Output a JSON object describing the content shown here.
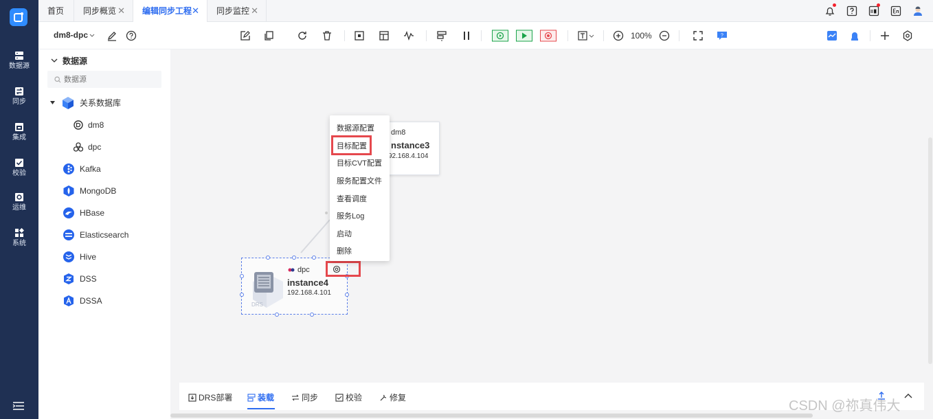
{
  "leftnav": {
    "items": [
      {
        "label": "数据源",
        "icon": "database-icon"
      },
      {
        "label": "同步",
        "icon": "sync-icon"
      },
      {
        "label": "集成",
        "icon": "integration-icon"
      },
      {
        "label": "校验",
        "icon": "check-icon"
      },
      {
        "label": "运维",
        "icon": "ops-icon"
      },
      {
        "label": "系统",
        "icon": "system-icon"
      }
    ]
  },
  "tabs": [
    {
      "label": "首页",
      "closable": false
    },
    {
      "label": "同步概览",
      "closable": true
    },
    {
      "label": "编辑同步工程",
      "closable": true,
      "active": true
    },
    {
      "label": "同步监控",
      "closable": true
    }
  ],
  "toolbar": {
    "project": "dm8-dpc",
    "zoom": "100%"
  },
  "sidebar": {
    "title": "数据源",
    "search_placeholder": "数据源",
    "tree": [
      {
        "label": "关系数据库",
        "icon": "relational-db-icon"
      },
      {
        "label": "dm8",
        "icon": "dm8-icon"
      },
      {
        "label": "dpc",
        "icon": "dpc-icon"
      },
      {
        "label": "Kafka",
        "icon": "kafka-icon"
      },
      {
        "label": "MongoDB",
        "icon": "mongodb-icon"
      },
      {
        "label": "HBase",
        "icon": "hbase-icon"
      },
      {
        "label": "Elasticsearch",
        "icon": "elasticsearch-icon"
      },
      {
        "label": "Hive",
        "icon": "hive-icon"
      },
      {
        "label": "DSS",
        "icon": "dss-icon"
      },
      {
        "label": "DSSA",
        "icon": "dssa-icon"
      }
    ]
  },
  "nodes": {
    "instance3": {
      "type": "dm8",
      "name": "nstance3",
      "ip": "92.168.4.104"
    },
    "instance4": {
      "type": "dpc",
      "name": "instance4",
      "ip": "192.168.4.101",
      "badge": "DRS"
    }
  },
  "context_menu": [
    "数据源配置",
    "目标配置",
    "目标CVT配置",
    "服务配置文件",
    "查看调度",
    "服务Log",
    "启动",
    "删除"
  ],
  "bottom_tabs": [
    {
      "label": "DRS部署",
      "active": false
    },
    {
      "label": "装载",
      "active": true
    },
    {
      "label": "同步",
      "active": false
    },
    {
      "label": "校验",
      "active": false
    },
    {
      "label": "修复",
      "active": false
    }
  ],
  "watermark": "CSDN @祢真伟大",
  "colors": {
    "nav_bg": "#1f3053",
    "accent": "#2d6cf0",
    "highlight": "#e5484d",
    "run_green": "#1aa34a",
    "stop_red": "#e5484d"
  }
}
